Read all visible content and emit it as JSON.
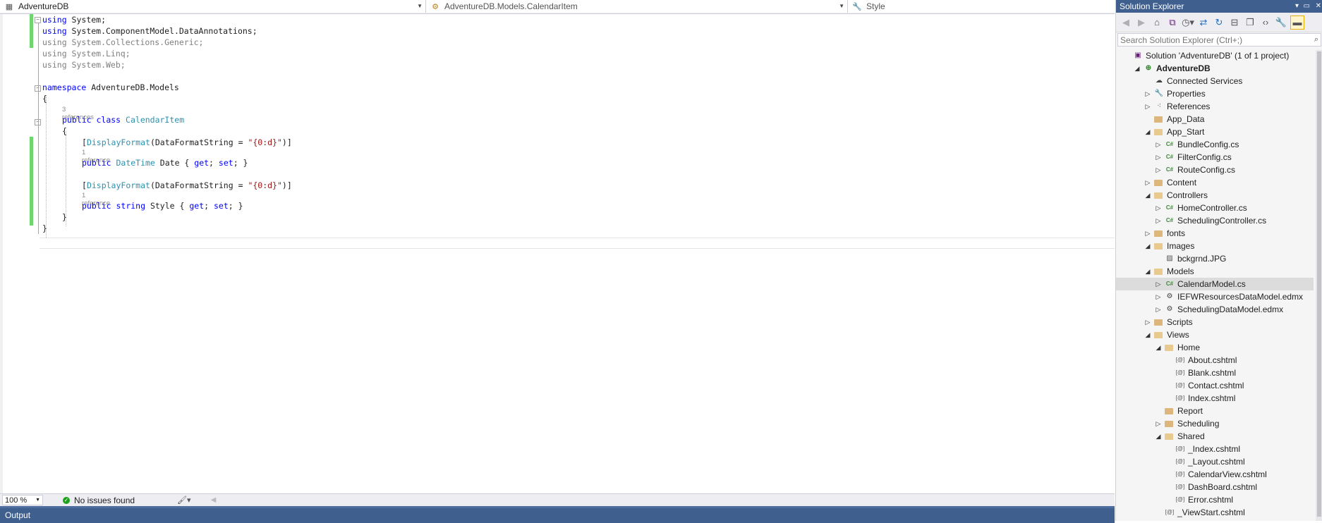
{
  "navbar": {
    "project": "AdventureDB",
    "type": "AdventureDB.Models.CalendarItem",
    "member": "Style",
    "project_icon": "csharp-project-icon",
    "type_icon": "class-icon",
    "member_icon": "wrench-icon"
  },
  "code": {
    "l1a": "using",
    "l1b": " System;",
    "l2a": "using",
    "l2b": " System.ComponentModel.DataAnnotations;",
    "l3": "using System.Collections.Generic;",
    "l4": "using System.Linq;",
    "l5": "using System.Web;",
    "l7a": "namespace",
    "l7b": " AdventureDB.Models",
    "l8": "{",
    "lens_class": "3 references",
    "l9a": "public",
    "l9b": " ",
    "l9c": "class",
    "l9d": " ",
    "l9e": "CalendarItem",
    "l10": "{",
    "l11a": "[",
    "l11b": "DisplayFormat",
    "l11c": "(DataFormatString = ",
    "l11d": "\"{0:d}\"",
    "l11e": ")]",
    "lens_date": "1 reference",
    "l12a": "public",
    "l12b": " ",
    "l12c": "DateTime",
    "l12d": " Date { ",
    "l12e": "get",
    "l12f": "; ",
    "l12g": "set",
    "l12h": "; }",
    "l13a": "[",
    "l13b": "DisplayFormat",
    "l13c": "(DataFormatString = ",
    "l13d": "\"{0:d}\"",
    "l13e": ")]",
    "lens_style": "1 reference",
    "l14a": "public",
    "l14b": " ",
    "l14c": "string",
    "l14d": " Style { ",
    "l14e": "get",
    "l14f": "; ",
    "l14g": "set",
    "l14h": "; }",
    "l15": "}",
    "l16": "}"
  },
  "status": {
    "zoom": "100 %",
    "issues": "No issues found"
  },
  "output_panel": {
    "title": "Output"
  },
  "solution_explorer": {
    "title": "Solution Explorer",
    "search_placeholder": "Search Solution Explorer (Ctrl+;)",
    "items": [
      {
        "label": "Solution 'AdventureDB' (1 of 1 project)",
        "icon": "solution-icon"
      },
      {
        "label": "AdventureDB",
        "icon": "project-icon"
      },
      {
        "label": "Connected Services",
        "icon": "connected-services-icon"
      },
      {
        "label": "Properties",
        "icon": "wrench-icon"
      },
      {
        "label": "References",
        "icon": "references-icon"
      },
      {
        "label": "App_Data",
        "icon": "folder-icon"
      },
      {
        "label": "App_Start",
        "icon": "folder-open-icon"
      },
      {
        "label": "BundleConfig.cs",
        "icon": "csharp-file-icon"
      },
      {
        "label": "FilterConfig.cs",
        "icon": "csharp-file-icon"
      },
      {
        "label": "RouteConfig.cs",
        "icon": "csharp-file-icon"
      },
      {
        "label": "Content",
        "icon": "folder-icon"
      },
      {
        "label": "Controllers",
        "icon": "folder-open-icon"
      },
      {
        "label": "HomeController.cs",
        "icon": "csharp-file-icon"
      },
      {
        "label": "SchedulingController.cs",
        "icon": "csharp-file-icon"
      },
      {
        "label": "fonts",
        "icon": "folder-icon"
      },
      {
        "label": "Images",
        "icon": "folder-open-icon"
      },
      {
        "label": "bckgrnd.JPG",
        "icon": "image-file-icon"
      },
      {
        "label": "Models",
        "icon": "folder-open-icon"
      },
      {
        "label": "CalendarModel.cs",
        "icon": "csharp-file-icon"
      },
      {
        "label": "IEFWResourcesDataModel.edmx",
        "icon": "edmx-icon"
      },
      {
        "label": "SchedulingDataModel.edmx",
        "icon": "edmx-icon"
      },
      {
        "label": "Scripts",
        "icon": "folder-icon"
      },
      {
        "label": "Views",
        "icon": "folder-open-icon"
      },
      {
        "label": "Home",
        "icon": "folder-open-icon"
      },
      {
        "label": "About.cshtml",
        "icon": "razor-file-icon"
      },
      {
        "label": "Blank.cshtml",
        "icon": "razor-file-icon"
      },
      {
        "label": "Contact.cshtml",
        "icon": "razor-file-icon"
      },
      {
        "label": "Index.cshtml",
        "icon": "razor-file-icon"
      },
      {
        "label": "Report",
        "icon": "folder-icon"
      },
      {
        "label": "Scheduling",
        "icon": "folder-icon"
      },
      {
        "label": "Shared",
        "icon": "folder-open-icon"
      },
      {
        "label": "_Index.cshtml",
        "icon": "razor-file-icon"
      },
      {
        "label": "_Layout.cshtml",
        "icon": "razor-file-icon"
      },
      {
        "label": "CalendarView.cshtml",
        "icon": "razor-file-icon"
      },
      {
        "label": "DashBoard.cshtml",
        "icon": "razor-file-icon"
      },
      {
        "label": "Error.cshtml",
        "icon": "razor-file-icon"
      },
      {
        "label": "_ViewStart.cshtml",
        "icon": "razor-file-icon"
      }
    ],
    "selected": "CalendarModel.cs"
  }
}
